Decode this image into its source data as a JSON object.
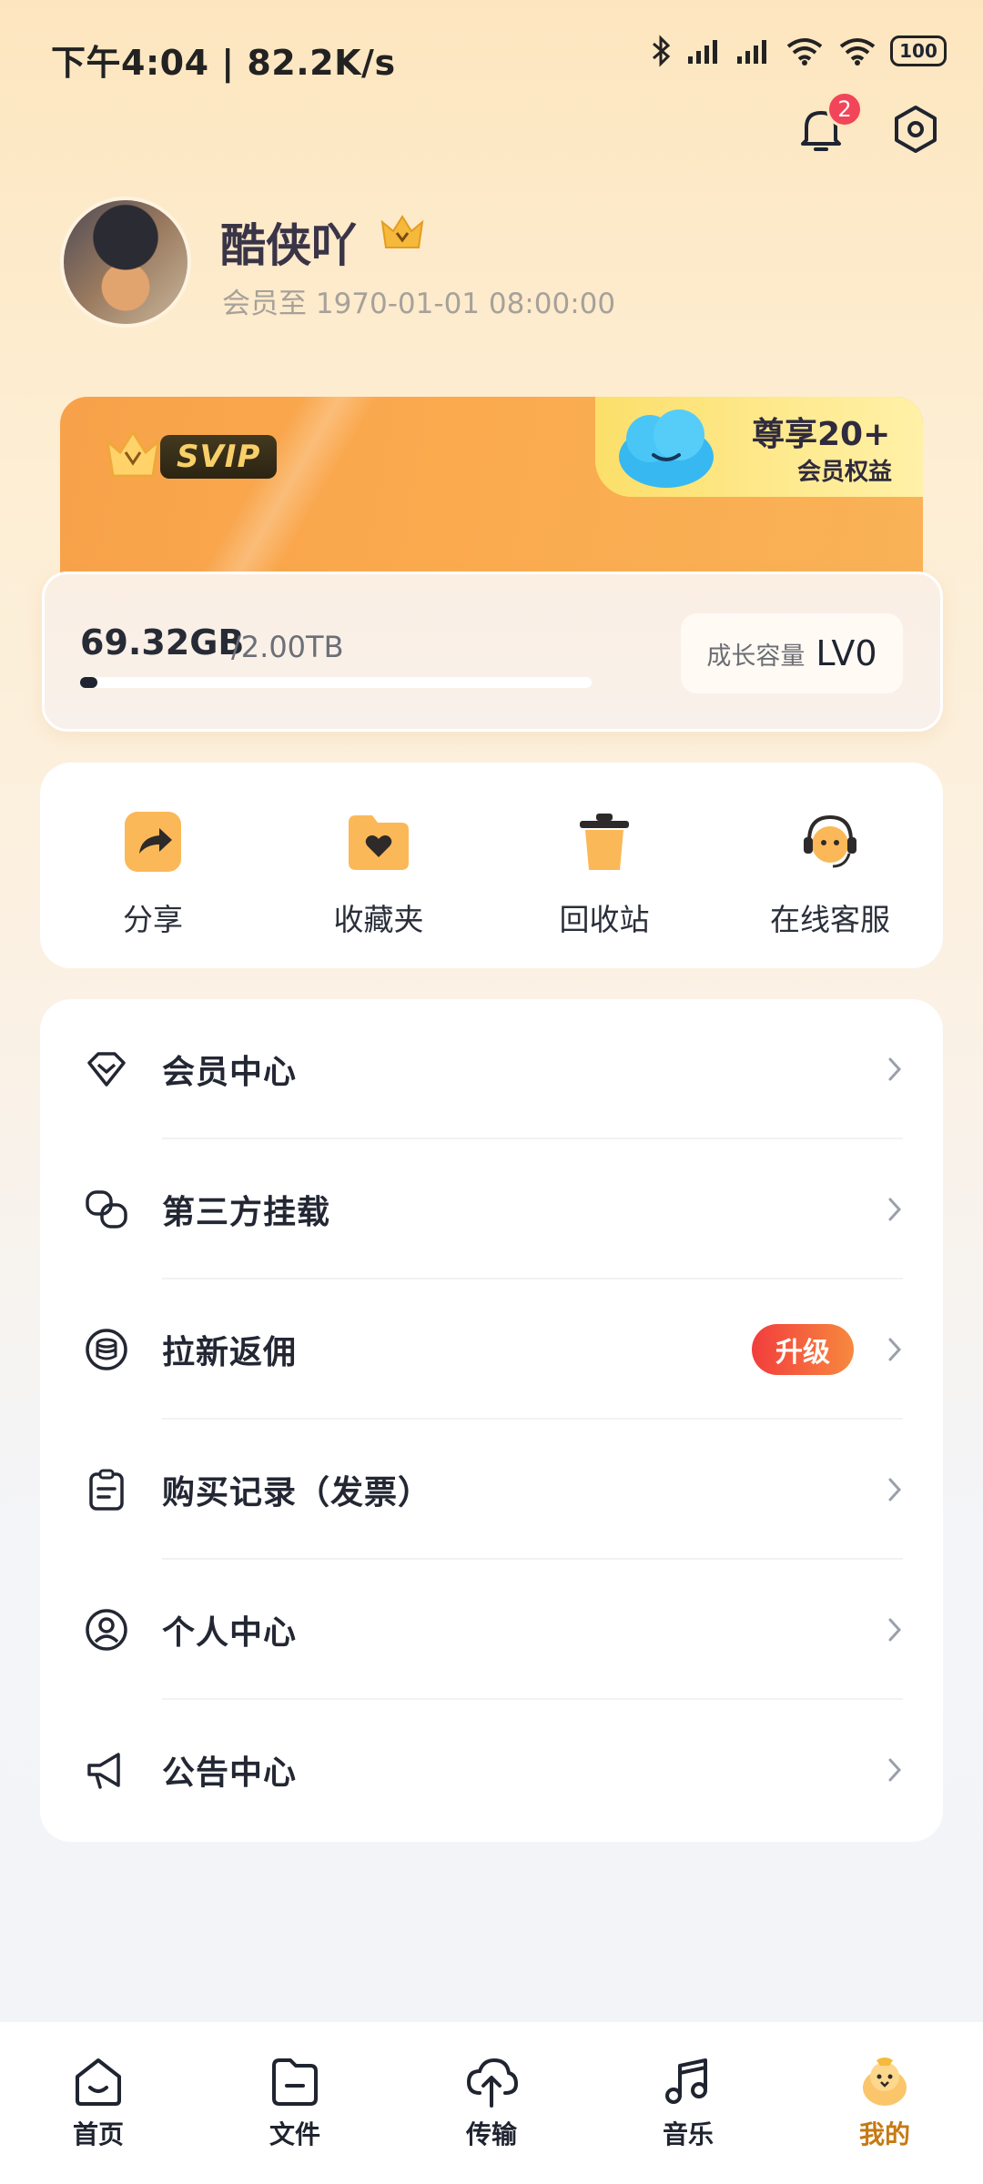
{
  "status": {
    "time": "下午4:04 | 82.2K/s",
    "battery": "100"
  },
  "notifications": {
    "badge_count": "2"
  },
  "profile": {
    "name": "酷侠吖",
    "member_until": "会员至 1970-01-01 08:00:00"
  },
  "svip_card": {
    "badge": "SVIP",
    "promo_line1": "尊享20+",
    "promo_line2": "会员权益"
  },
  "storage": {
    "used": "69.32GB",
    "total": "/2.00TB",
    "used_fraction": 0.034,
    "growth_label": "成长容量",
    "growth_level": "LV0"
  },
  "quick_actions": [
    {
      "label": "分享",
      "icon": "share-icon"
    },
    {
      "label": "收藏夹",
      "icon": "favorites-folder-icon"
    },
    {
      "label": "回收站",
      "icon": "trash-icon"
    },
    {
      "label": "在线客服",
      "icon": "customer-service-icon"
    }
  ],
  "menu": [
    {
      "label": "会员中心",
      "icon": "diamond-icon"
    },
    {
      "label": "第三方挂载",
      "icon": "link-icon"
    },
    {
      "label": "拉新返佣",
      "icon": "coin-stack-icon",
      "badge": "升级"
    },
    {
      "label": "购买记录（发票）",
      "icon": "clipboard-icon"
    },
    {
      "label": "个人中心",
      "icon": "user-circle-icon"
    },
    {
      "label": "公告中心",
      "icon": "megaphone-icon"
    }
  ],
  "bottom_nav": [
    {
      "label": "首页",
      "icon": "home-icon"
    },
    {
      "label": "文件",
      "icon": "folder-icon"
    },
    {
      "label": "传输",
      "icon": "cloud-transfer-icon"
    },
    {
      "label": "音乐",
      "icon": "music-note-icon"
    },
    {
      "label": "我的",
      "icon": "mascot-icon",
      "active": true
    }
  ],
  "colors": {
    "accent_orange": "#f7a24a",
    "badge_red": "#f2455a",
    "active_nav": "#c57a12"
  }
}
